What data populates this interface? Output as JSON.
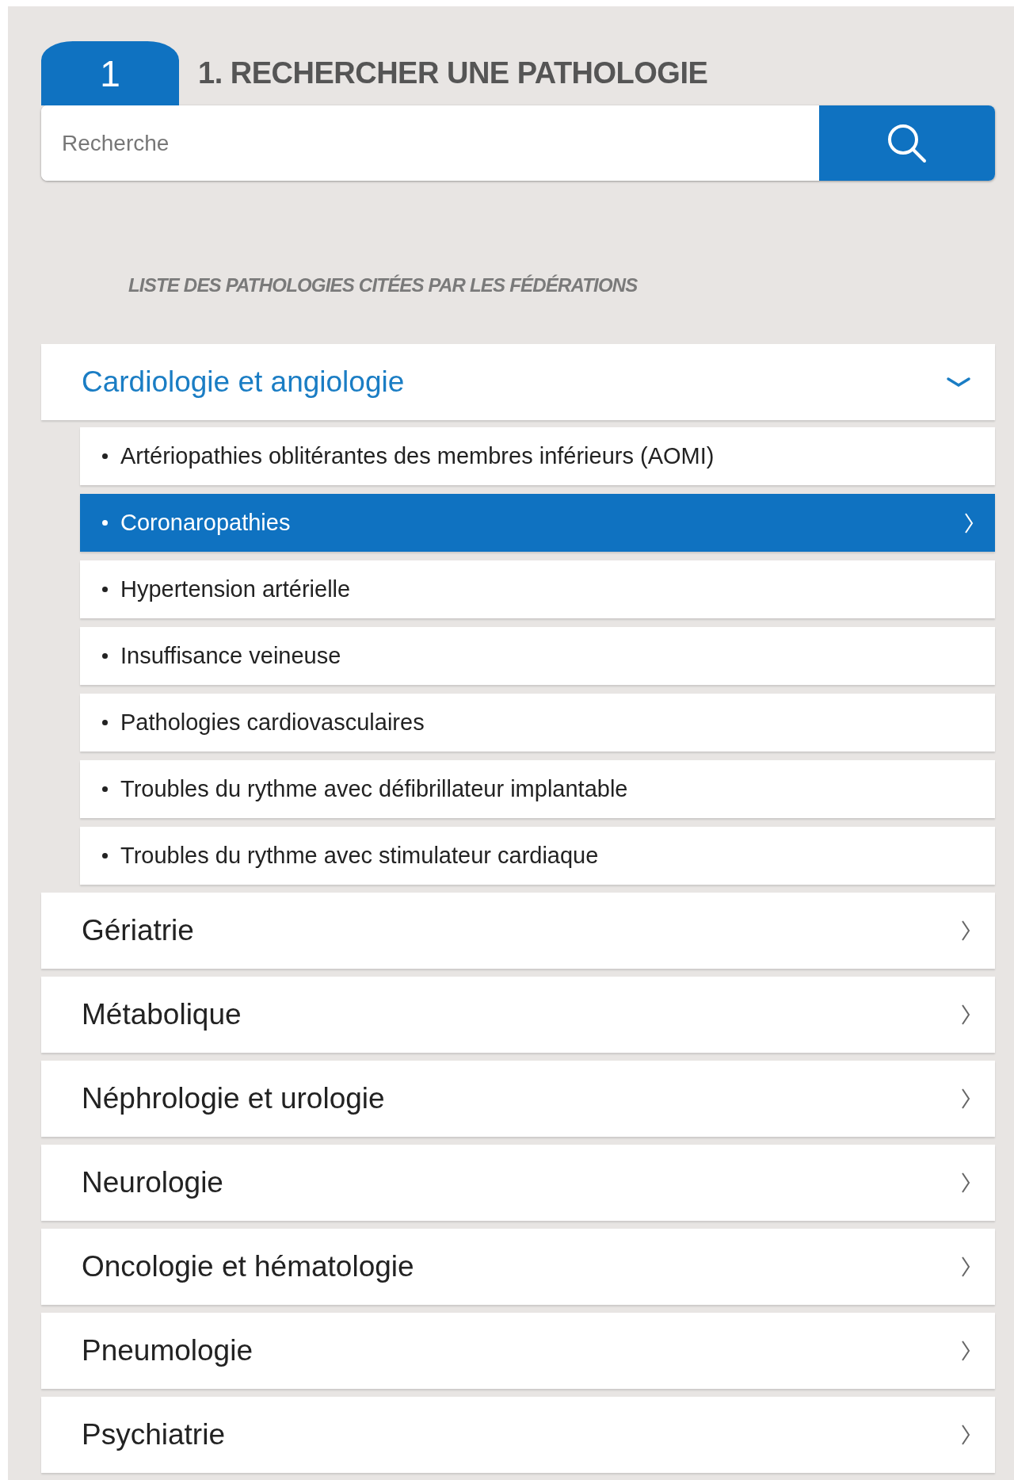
{
  "step": {
    "number": "1",
    "title": "1. RECHERCHER UNE PATHOLOGIE"
  },
  "search": {
    "placeholder": "Recherche"
  },
  "list_title": "LISTE DES PATHOLOGIES CITÉES PAR LES FÉDÉRATIONS",
  "categories": [
    {
      "label": "Cardiologie et angiologie",
      "expanded": true,
      "children": [
        {
          "label": "Artériopathies oblitérantes des membres inférieurs (AOMI)",
          "selected": false
        },
        {
          "label": "Coronaropathies",
          "selected": true
        },
        {
          "label": "Hypertension artérielle",
          "selected": false
        },
        {
          "label": "Insuffisance veineuse",
          "selected": false
        },
        {
          "label": "Pathologies cardiovasculaires",
          "selected": false
        },
        {
          "label": "Troubles du rythme avec défibrillateur implantable",
          "selected": false
        },
        {
          "label": "Troubles du rythme avec stimulateur cardiaque",
          "selected": false
        }
      ]
    },
    {
      "label": "Gériatrie",
      "expanded": false
    },
    {
      "label": "Métabolique",
      "expanded": false
    },
    {
      "label": "Néphrologie et urologie",
      "expanded": false
    },
    {
      "label": "Neurologie",
      "expanded": false
    },
    {
      "label": "Oncologie et hématologie",
      "expanded": false
    },
    {
      "label": "Pneumologie",
      "expanded": false
    },
    {
      "label": "Psychiatrie",
      "expanded": false
    }
  ]
}
